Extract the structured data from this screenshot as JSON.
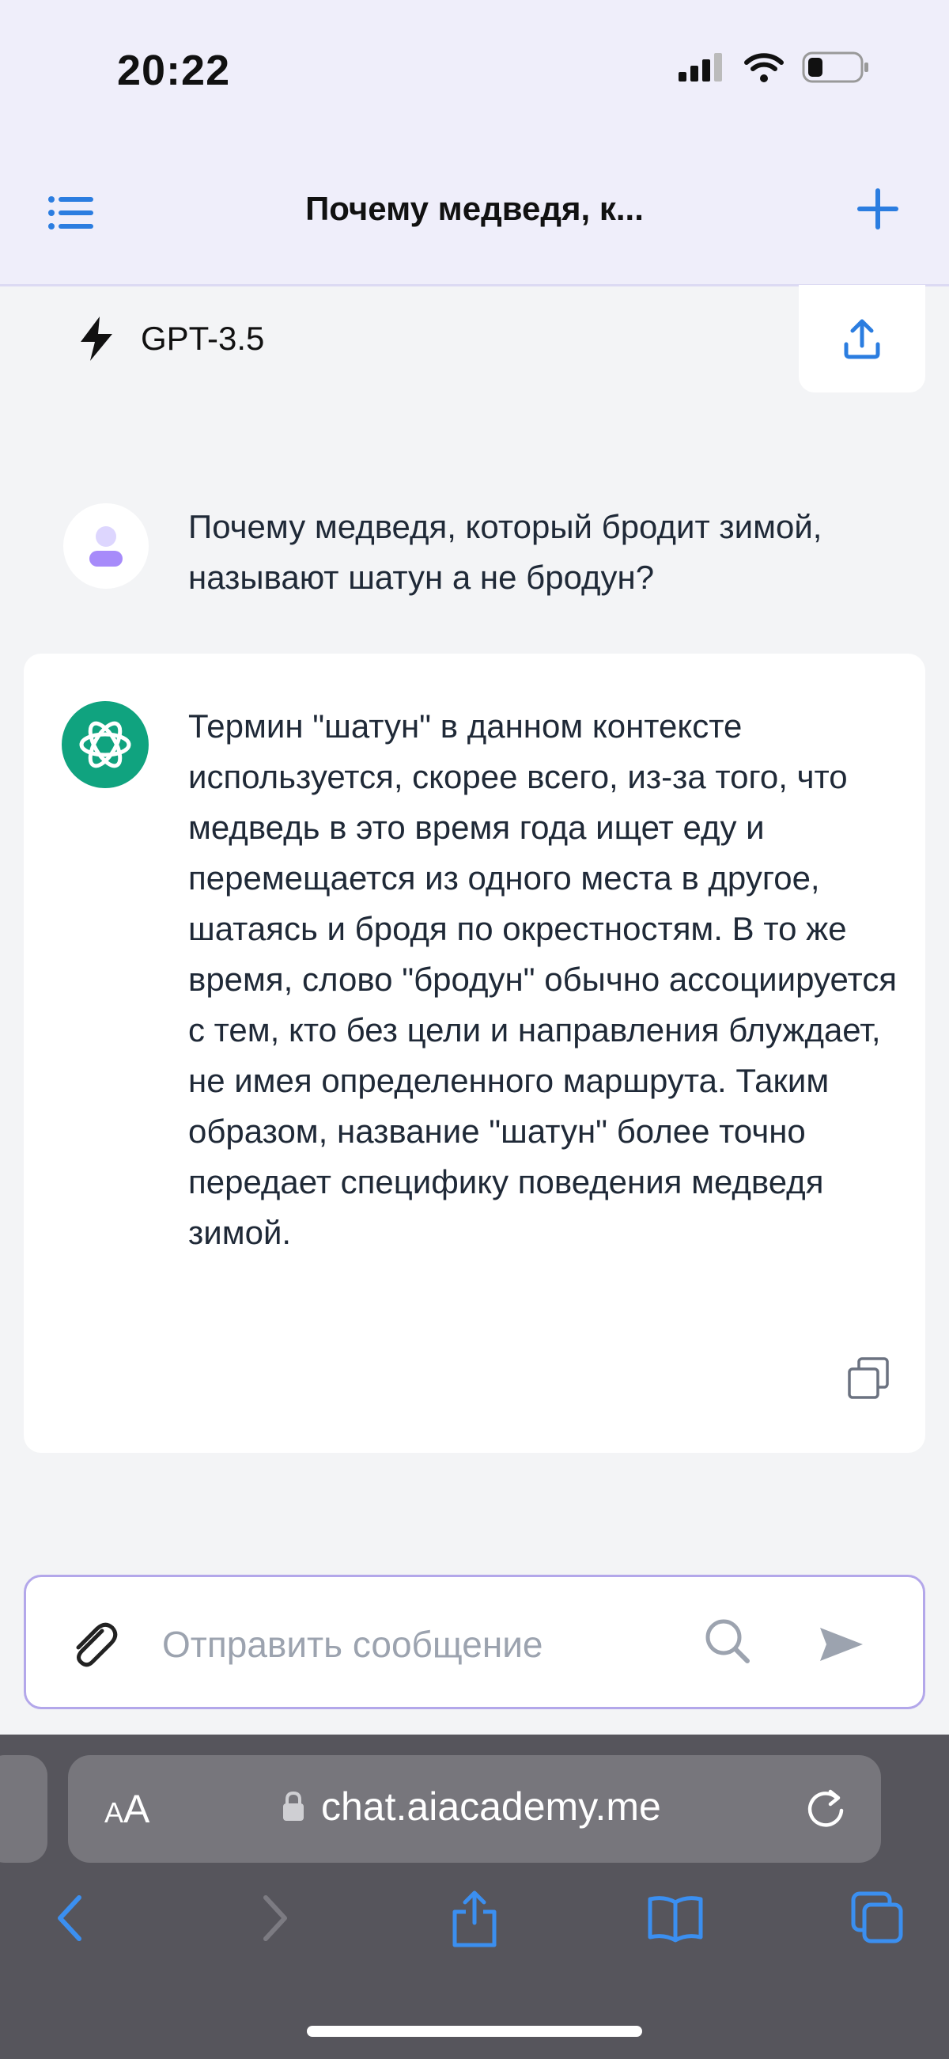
{
  "status_bar": {
    "time": "20:22"
  },
  "header": {
    "title": "Почему медведя, к..."
  },
  "model": {
    "label": "GPT-3.5"
  },
  "messages": {
    "user": "Почему медведя, который бродит зимой, называют шатун а не бродун?",
    "assistant": "Термин \"шатун\" в данном контексте используется, скорее всего, из-за того, что медведь в это время года ищет еду и перемещается из одного места в другое, шатаясь и бродя по окрестностям. В то же время, слово \"бродун\" обычно ассоциируется с тем, кто без цели и направления блуждает, не имея определенного маршрута. Таким образом, название \"шатун\" более точно передает специфику поведения медведя зимой."
  },
  "composer": {
    "placeholder": "Отправить сообщение"
  },
  "browser": {
    "aa_large": "A",
    "aa_small": "A",
    "url": "chat.aiacademy.me"
  },
  "colors": {
    "accent": "#2b7de0",
    "header_bg": "#efeefa",
    "page_bg": "#f3f4f6",
    "composer_border": "#b3a7ea",
    "openai_green": "#10a37f",
    "safari_bar": "#56555c",
    "safari_blue": "#3b8ff0"
  },
  "icons": [
    "menu-icon",
    "plus-icon",
    "bolt-icon",
    "share-upload-icon",
    "user-avatar-icon",
    "openai-logo-icon",
    "copy-icon",
    "paperclip-icon",
    "search-icon",
    "send-icon",
    "lock-icon",
    "reload-icon",
    "back-icon",
    "forward-icon",
    "share-icon",
    "bookmarks-icon",
    "tabs-icon",
    "signal-icon",
    "wifi-icon",
    "battery-icon"
  ]
}
